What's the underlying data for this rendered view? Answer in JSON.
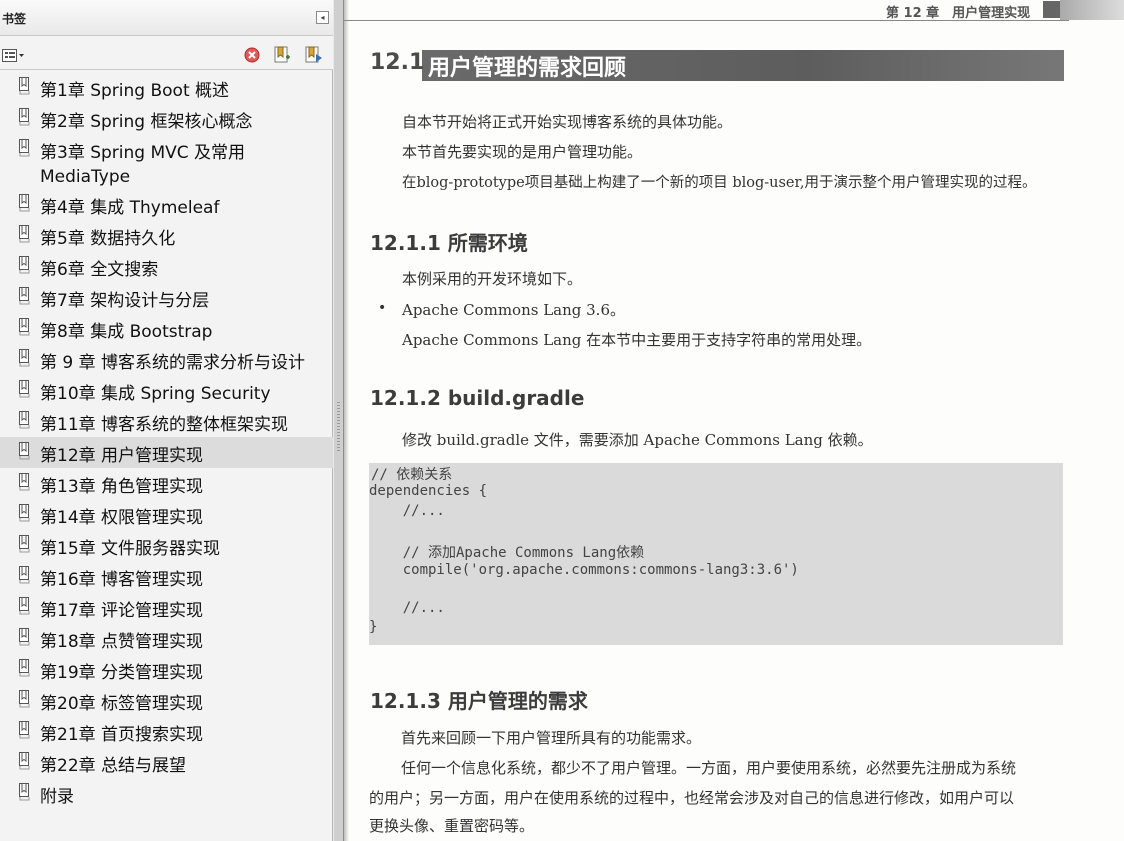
{
  "bookmarks_panel": {
    "title": "书签",
    "collapse_glyph": "◂",
    "items": [
      {
        "label": "第1章 Spring Boot 概述"
      },
      {
        "label": "第2章 Spring 框架核心概念"
      },
      {
        "label": "第3章 Spring MVC 及常用 MediaType"
      },
      {
        "label": "第4章 集成 Thymeleaf"
      },
      {
        "label": "第5章 数据持久化"
      },
      {
        "label": "第6章 全文搜索"
      },
      {
        "label": "第7章 架构设计与分层"
      },
      {
        "label": "第8章 集成 Bootstrap"
      },
      {
        "label": "第 9 章 博客系统的需求分析与设计"
      },
      {
        "label": "第10章 集成 Spring Security"
      },
      {
        "label": "第11章 博客系统的整体框架实现"
      },
      {
        "label": "第12章 用户管理实现"
      },
      {
        "label": "第13章 角色管理实现"
      },
      {
        "label": "第14章 权限管理实现"
      },
      {
        "label": "第15章 文件服务器实现"
      },
      {
        "label": "第16章 博客管理实现"
      },
      {
        "label": "第17章 评论管理实现"
      },
      {
        "label": "第18章 点赞管理实现"
      },
      {
        "label": "第19章 分类管理实现"
      },
      {
        "label": "第20章 标签管理实现"
      },
      {
        "label": "第21章 首页搜索实现"
      },
      {
        "label": "第22章 总结与展望"
      },
      {
        "label": "附录"
      }
    ],
    "selected_index": 11,
    "icons": [
      "options-menu-icon",
      "delete-bookmark-icon",
      "new-bookmark-icon",
      "expand-bookmark-icon",
      "bookmark-icon"
    ]
  },
  "page": {
    "running_head": "第 12 章　用户管理实现",
    "section": {
      "number": "12.1",
      "title": "用户管理的需求回顾"
    },
    "intro": [
      "自本节开始将正式开始实现博客系统的具体功能。",
      "本节首先要实现的是用户管理功能。",
      "在blog-prototype项目基础上构建了一个新的项目 blog-user,用于演示整个用户管理实现的过程。"
    ],
    "sub1": {
      "heading": "12.1.1 所需环境",
      "lead": "本例采用的开发环境如下。",
      "bullet": "Apache Commons Lang 3.6。",
      "note": "Apache Commons Lang 在本节中主要用于支持字符串的常用处理。"
    },
    "sub2": {
      "heading": "12.1.2 build.gradle",
      "lead": "修改 build.gradle 文件，需要添加 Apache Commons Lang 依赖。",
      "code": [
        "// 依赖关系",
        "dependencies {",
        "    //...",
        "",
        "    // 添加Apache Commons Lang依赖",
        "    compile('org.apache.commons:commons-lang3:3.6')",
        "",
        "    //...",
        "}"
      ]
    },
    "sub3": {
      "heading": "12.1.3 用户管理的需求",
      "lead": "首先来回顾一下用户管理所具有的功能需求。",
      "para_lines": [
        "任何一个信息化系统，都少不了用户管理。一方面，用户要使用系统，必然要先注册成为系统",
        "的用户；另一方面，用户在使用系统的过程中，也经常会涉及对自己的信息进行修改，如用户可以",
        "更换头像、重置密码等。"
      ]
    }
  },
  "colors": {
    "selected_row": "#dcdcdc",
    "title_bar": "#636363",
    "code_bg": "#dadada"
  }
}
